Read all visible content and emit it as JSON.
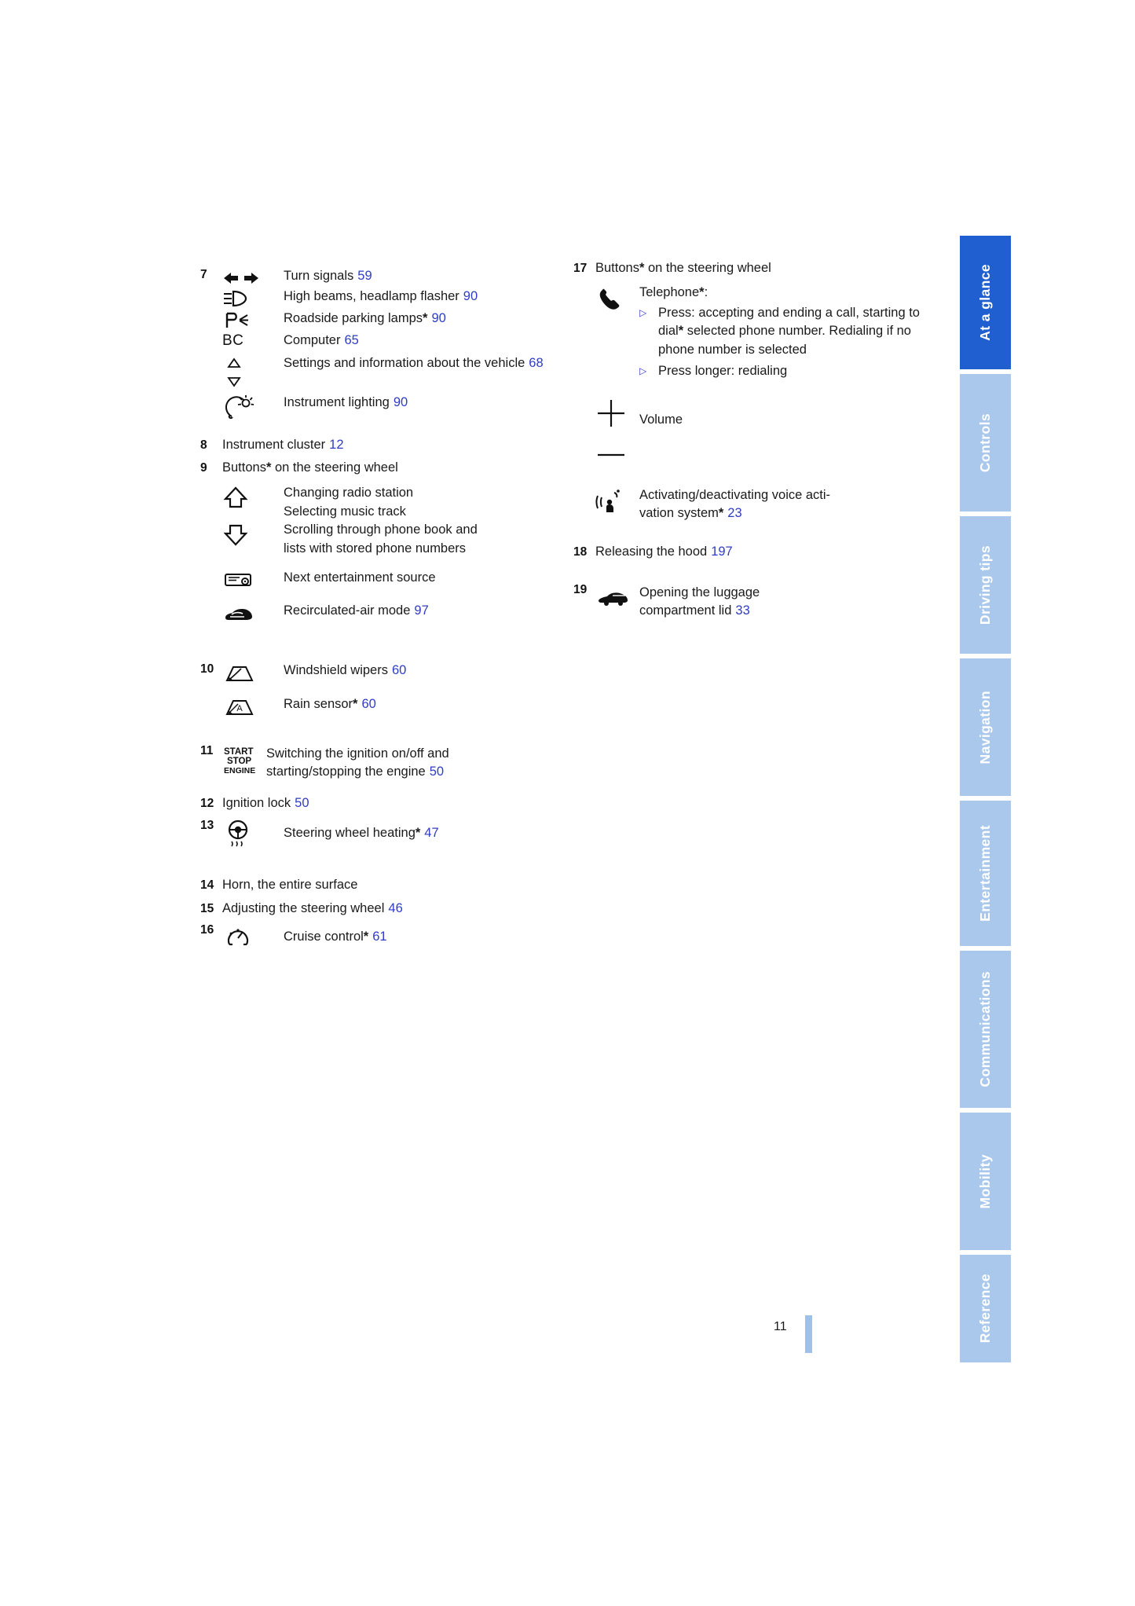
{
  "page": {
    "folio": "11",
    "accent_blue": "#2f3cc4",
    "tab_active_bg": "#1f5fd0",
    "tab_inactive_bg": "#a9c8ec"
  },
  "side_tabs": [
    {
      "label": "At a glance",
      "active": true
    },
    {
      "label": "Controls",
      "active": false
    },
    {
      "label": "Driving tips",
      "active": false
    },
    {
      "label": "Navigation",
      "active": false
    },
    {
      "label": "Entertainment",
      "active": false
    },
    {
      "label": "Communications",
      "active": false
    },
    {
      "label": "Mobility",
      "active": false
    },
    {
      "label": "Reference",
      "active": false
    }
  ],
  "left_column": {
    "item7": {
      "number": "7",
      "entries": [
        {
          "icon": "turn-signals-icon",
          "text": "Turn signals",
          "page": "59"
        },
        {
          "icon": "high-beams-icon",
          "text": "High beams, headlamp flasher",
          "page": "90"
        },
        {
          "icon": "parking-lamps-icon",
          "text": "Roadside parking lamps",
          "star": "*",
          "page": "90"
        },
        {
          "icon": "bc-computer-icon",
          "text": "Computer",
          "page": "65"
        },
        {
          "icon": "up-down-arrows-icon",
          "text": "Settings and information about the vehicle",
          "page": "68"
        },
        {
          "icon": "instrument-lighting-icon",
          "text": "Instrument lighting",
          "page": "90"
        }
      ]
    },
    "item8": {
      "number": "8",
      "text": "Instrument cluster",
      "page": "12"
    },
    "item9": {
      "number": "9",
      "text": "Buttons",
      "star": "*",
      "text_tail": " on the steering wheel",
      "entries": [
        {
          "icon": "up-down-rocker-icon",
          "lines": [
            "Changing radio station",
            "Selecting music track",
            "Scrolling through phone book and",
            "lists with stored phone numbers"
          ]
        },
        {
          "icon": "entertainment-source-icon",
          "text": "Next entertainment source"
        },
        {
          "icon": "recirculated-air-icon",
          "text": "Recirculated-air mode",
          "page": "97"
        }
      ]
    },
    "item10": {
      "number": "10",
      "entries": [
        {
          "icon": "windshield-wipers-icon",
          "text": "Windshield wipers",
          "page": "60"
        },
        {
          "icon": "rain-sensor-icon",
          "text": "Rain sensor",
          "star": "*",
          "page": "60"
        }
      ]
    },
    "item11": {
      "number": "11",
      "icon": "start-stop-engine-icon",
      "line1": "Switching the ignition on/off and",
      "line2": "starting/stopping the engine",
      "page": "50"
    },
    "item12": {
      "number": "12",
      "text": "Ignition lock",
      "page": "50"
    },
    "item13": {
      "number": "13",
      "icon": "steering-wheel-heating-icon",
      "text": "Steering wheel heating",
      "star": "*",
      "page": "47"
    },
    "item14": {
      "number": "14",
      "text": "Horn, the entire surface"
    },
    "item15": {
      "number": "15",
      "text": "Adjusting the steering wheel",
      "page": "46"
    },
    "item16": {
      "number": "16",
      "icon": "cruise-control-icon",
      "text": "Cruise control",
      "star": "*",
      "page": "61"
    }
  },
  "right_column": {
    "item17": {
      "number": "17",
      "text": "Buttons",
      "star": "*",
      "text_tail": " on the steering wheel",
      "telephone": {
        "icon": "telephone-handset-icon",
        "heading": "Telephone",
        "heading_star": "*",
        "heading_tail": ":",
        "bullets": [
          "Press: accepting and ending a call, starting to dial selected phone number. Redialing if no phone number is selected",
          "Press longer: redialing"
        ],
        "bullet1_lines": [
          "Press: accepting and ending a",
          "call, starting to dial",
          " selected",
          "phone number. Redialing if no",
          "phone number is selected"
        ],
        "bullet1_star": "*",
        "bullet2": "Press longer: redialing"
      },
      "volume": {
        "icon": "volume-plus-minus-icon",
        "text": "Volume"
      },
      "voice": {
        "icon": "voice-activation-icon",
        "line1": "Activating/deactivating voice acti-",
        "line2": "vation system",
        "star": "*",
        "page": "23"
      }
    },
    "item18": {
      "number": "18",
      "text": "Releasing the hood",
      "page": "197"
    },
    "item19": {
      "number": "19",
      "icon": "luggage-compartment-icon",
      "line1": "Opening the luggage",
      "line2": "compartment lid",
      "page": "33"
    }
  }
}
